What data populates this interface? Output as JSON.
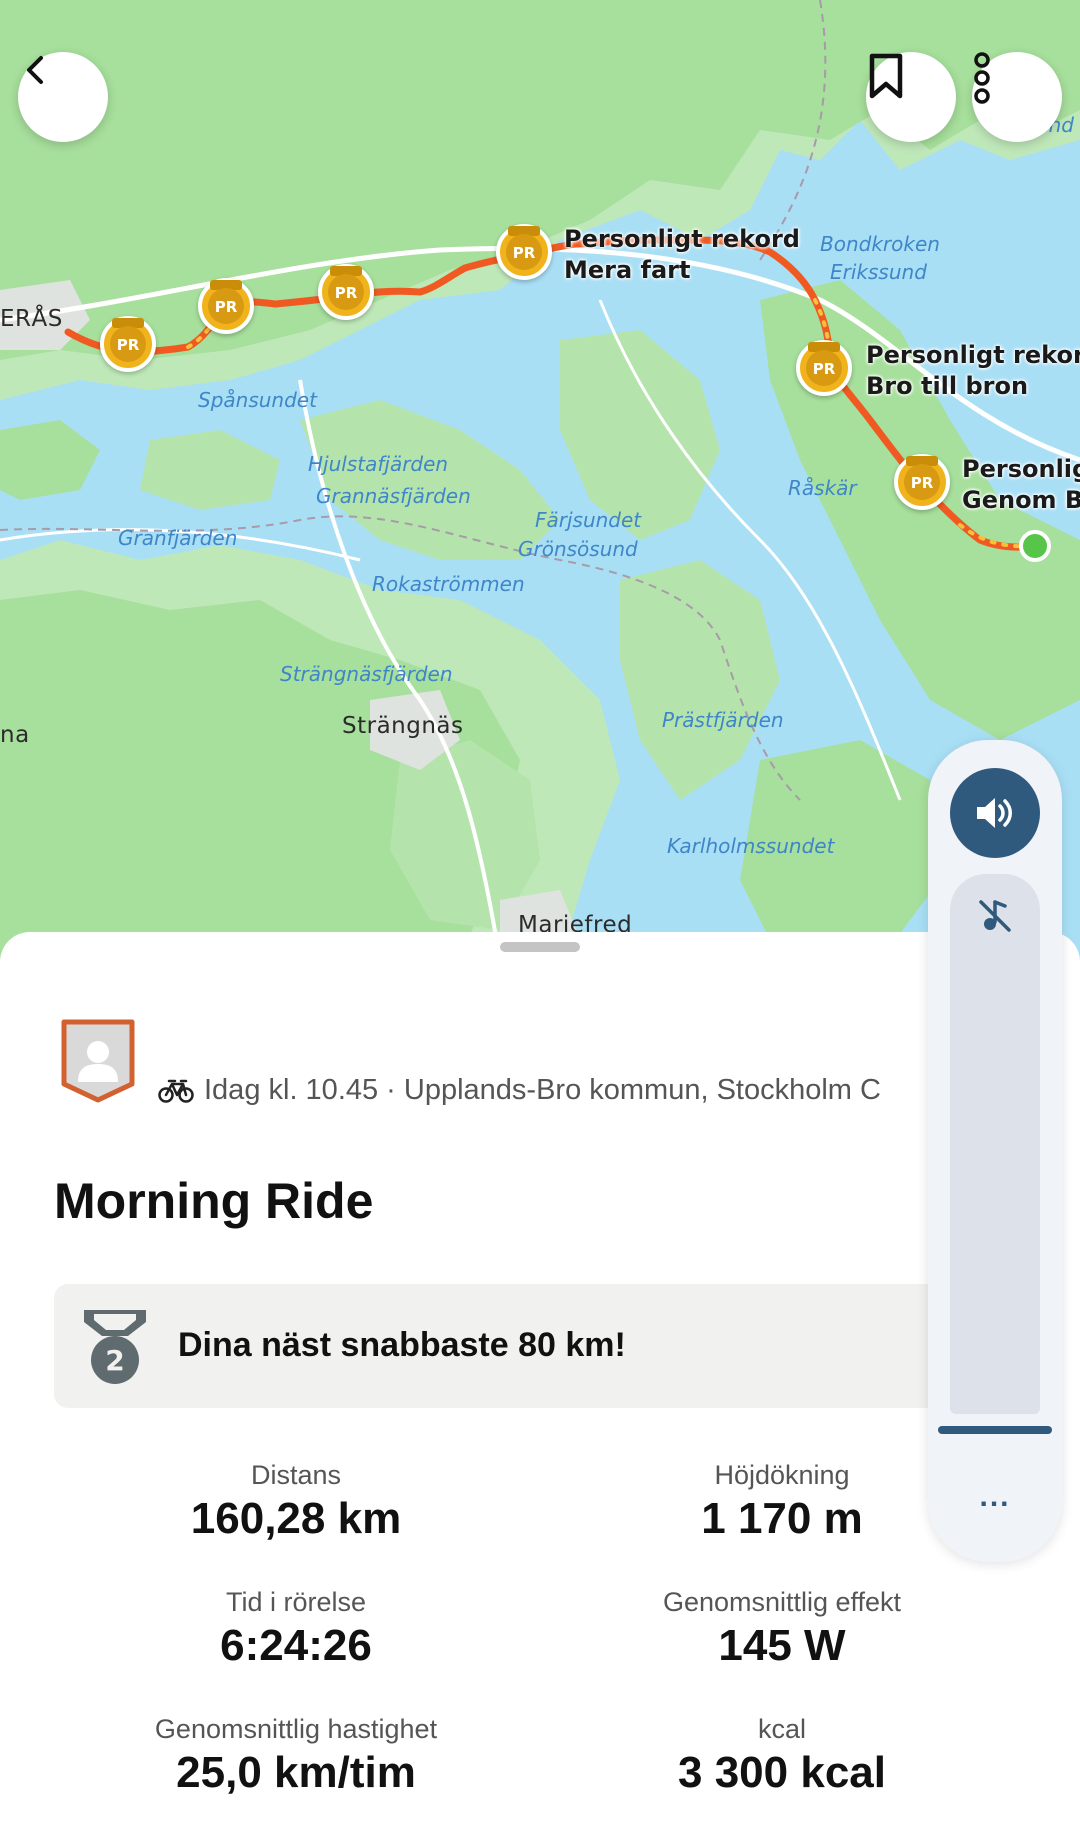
{
  "map": {
    "water_labels": [
      "Spånsundet",
      "Hjulstafjärden",
      "Grannäsfjärden",
      "Granfjärden",
      "Färjsundet",
      "Grönsösund",
      "Rokaströmmen",
      "Strängnäsfjärden",
      "Prästfjärden",
      "Karlholmssundet",
      "Bondkroken",
      "Erikssund",
      "Råskär",
      "Ävsund"
    ],
    "town_labels": [
      "ERÅS",
      "Strängnäs",
      "Mariefred",
      "na"
    ],
    "pr_annotations": [
      {
        "line1": "Personligt rekord",
        "line2": "Mera fart"
      },
      {
        "line1": "Personligt rekord",
        "line2": "Bro till bron"
      },
      {
        "line1": "Personligt",
        "line2": "Genom Br"
      }
    ],
    "pr_badge_label": "PR",
    "route_color": "#f05a22",
    "end_marker_color": "#57c44a"
  },
  "header": {
    "back_icon": "chevron-left-icon",
    "bookmark_icon": "bookmark-icon",
    "more_icon": "more-vertical-icon"
  },
  "activity": {
    "sport_icon": "bike-icon",
    "meta": "Idag kl. 10.45 · Upplands-Bro kommun, Stockholm C",
    "title": "Morning Ride",
    "achievement": {
      "medal_rank": "2",
      "text": "Dina näst snabbaste 80 km!"
    },
    "stats": [
      {
        "label": "Distans",
        "value": "160,28 km"
      },
      {
        "label": "Höjdökning",
        "value": "1 170 m"
      },
      {
        "label": "Tid i rörelse",
        "value": "6:24:26"
      },
      {
        "label": "Genomsnittlig effekt",
        "value": "145 W"
      },
      {
        "label": "Genomsnittlig hastighet",
        "value": "25,0 km/tim"
      },
      {
        "label": "kcal",
        "value": "3 300 kcal"
      }
    ]
  },
  "volume_panel": {
    "speaker_icon": "speaker-icon",
    "mute_icon": "music-off-icon",
    "more_label": "...",
    "level": 1.0,
    "accent": "#2f5a7e"
  }
}
